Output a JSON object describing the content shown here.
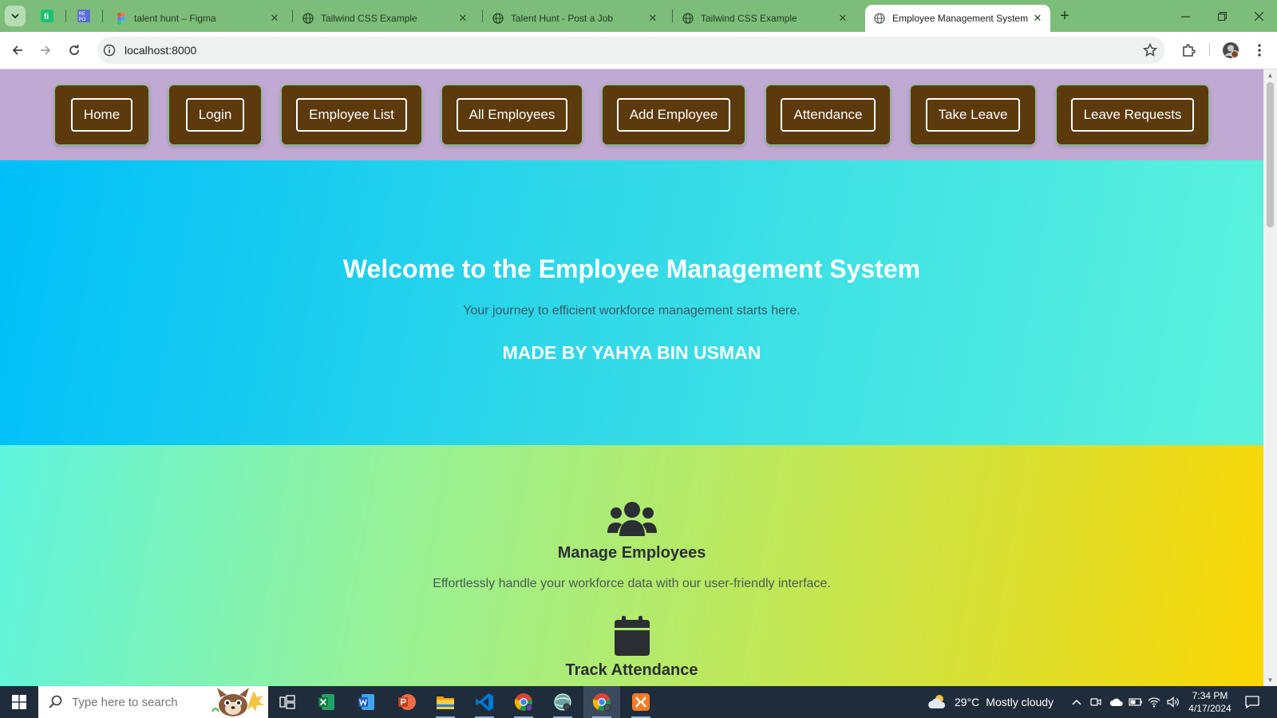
{
  "browser": {
    "tabs": [
      {
        "title": "talent hunt – Figma"
      },
      {
        "title": "Tailwind CSS Example"
      },
      {
        "title": "Talent Hunt - Post a Job"
      },
      {
        "title": "Tailwind CSS Example"
      },
      {
        "title": "Employee Management System",
        "active": true
      }
    ],
    "url": "localhost:8000"
  },
  "nav": {
    "items": [
      {
        "label": "Home"
      },
      {
        "label": "Login"
      },
      {
        "label": "Employee List"
      },
      {
        "label": "All Employees"
      },
      {
        "label": "Add Employee"
      },
      {
        "label": "Attendance"
      },
      {
        "label": "Take Leave"
      },
      {
        "label": "Leave Requests"
      }
    ]
  },
  "hero": {
    "title": "Welcome to the Employee Management System",
    "subtitle": "Your journey to efficient workforce management starts here.",
    "credit": "MADE BY YAHYA BIN USMAN"
  },
  "features": [
    {
      "icon": "users-icon",
      "title": "Manage Employees",
      "description": "Effortlessly handle your workforce data with our user-friendly interface."
    },
    {
      "icon": "calendar-icon",
      "title": "Track Attendance",
      "description": ""
    }
  ],
  "taskbar": {
    "search_placeholder": "Type here to search",
    "weather": {
      "temp": "29°C",
      "condition": "Mostly cloudy"
    },
    "time": "7:34 PM",
    "date": "4/17/2024"
  },
  "colors": {
    "tab_strip": "#7dbd7a",
    "navbar_bg": "#c0a9d3",
    "nav_button_bg": "#5c3a0e",
    "hero_gradient_start": "#00bff8",
    "hero_gradient_end": "#5cf3dd",
    "features_gradient_start": "#5ff5df",
    "features_gradient_end": "#fbd603"
  }
}
